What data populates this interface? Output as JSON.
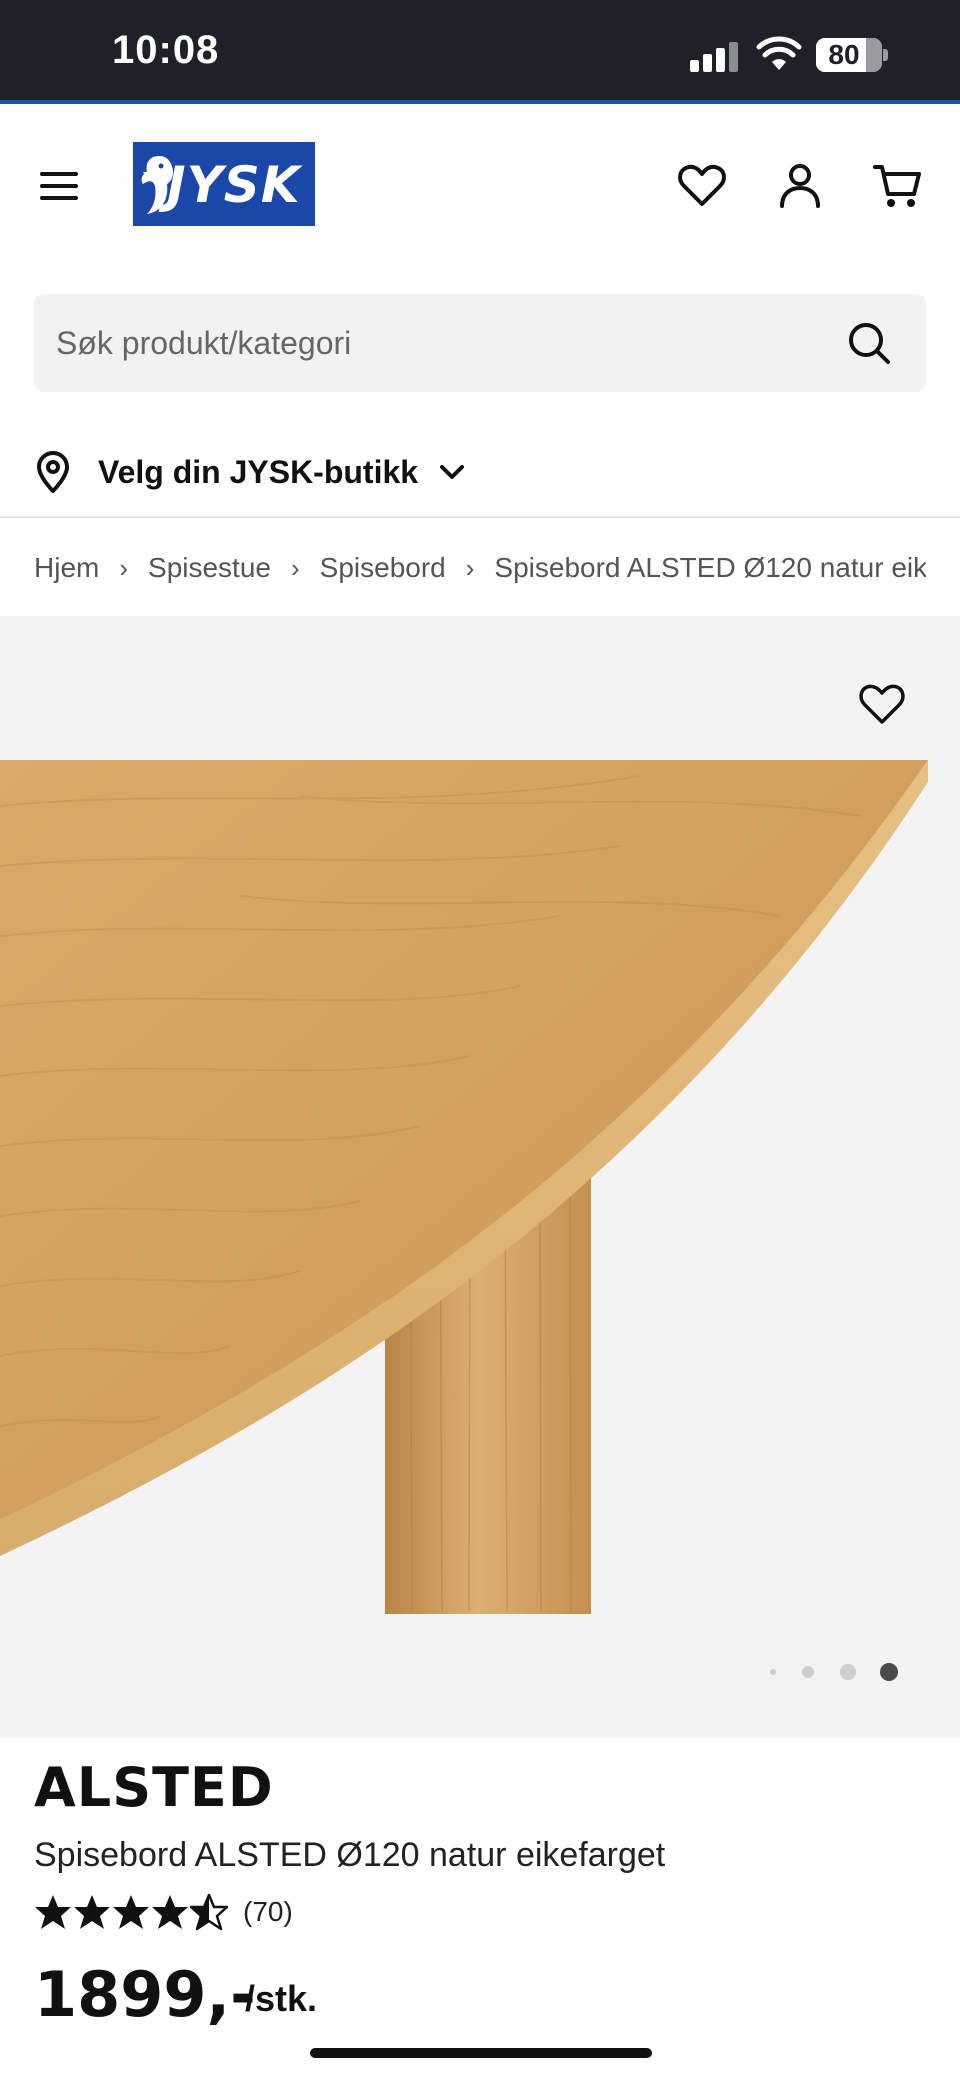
{
  "status_bar": {
    "time": "10:08",
    "battery_percent": "80",
    "signal_bars_active": 3,
    "signal_bars_total": 4
  },
  "header": {
    "logo_text": "JYSK",
    "brand_color": "#1b48a8",
    "icons": [
      "menu-icon",
      "heart-icon",
      "user-icon",
      "cart-icon"
    ]
  },
  "search": {
    "placeholder": "Søk produkt/kategori"
  },
  "store_selector": {
    "label": "Velg din JYSK-butikk"
  },
  "breadcrumb": {
    "items": [
      "Hjem",
      "Spisestue",
      "Spisebord",
      "Spisebord ALSTED Ø120 natur eike"
    ]
  },
  "gallery": {
    "image_count": 4,
    "active_index": 3
  },
  "product": {
    "brand": "ALSTED",
    "name": "Spisebord ALSTED Ø120 natur eikefarget",
    "rating": 4.5,
    "rating_max": 5,
    "rating_count": "(70)",
    "price": "1899,-",
    "unit": "/stk."
  }
}
